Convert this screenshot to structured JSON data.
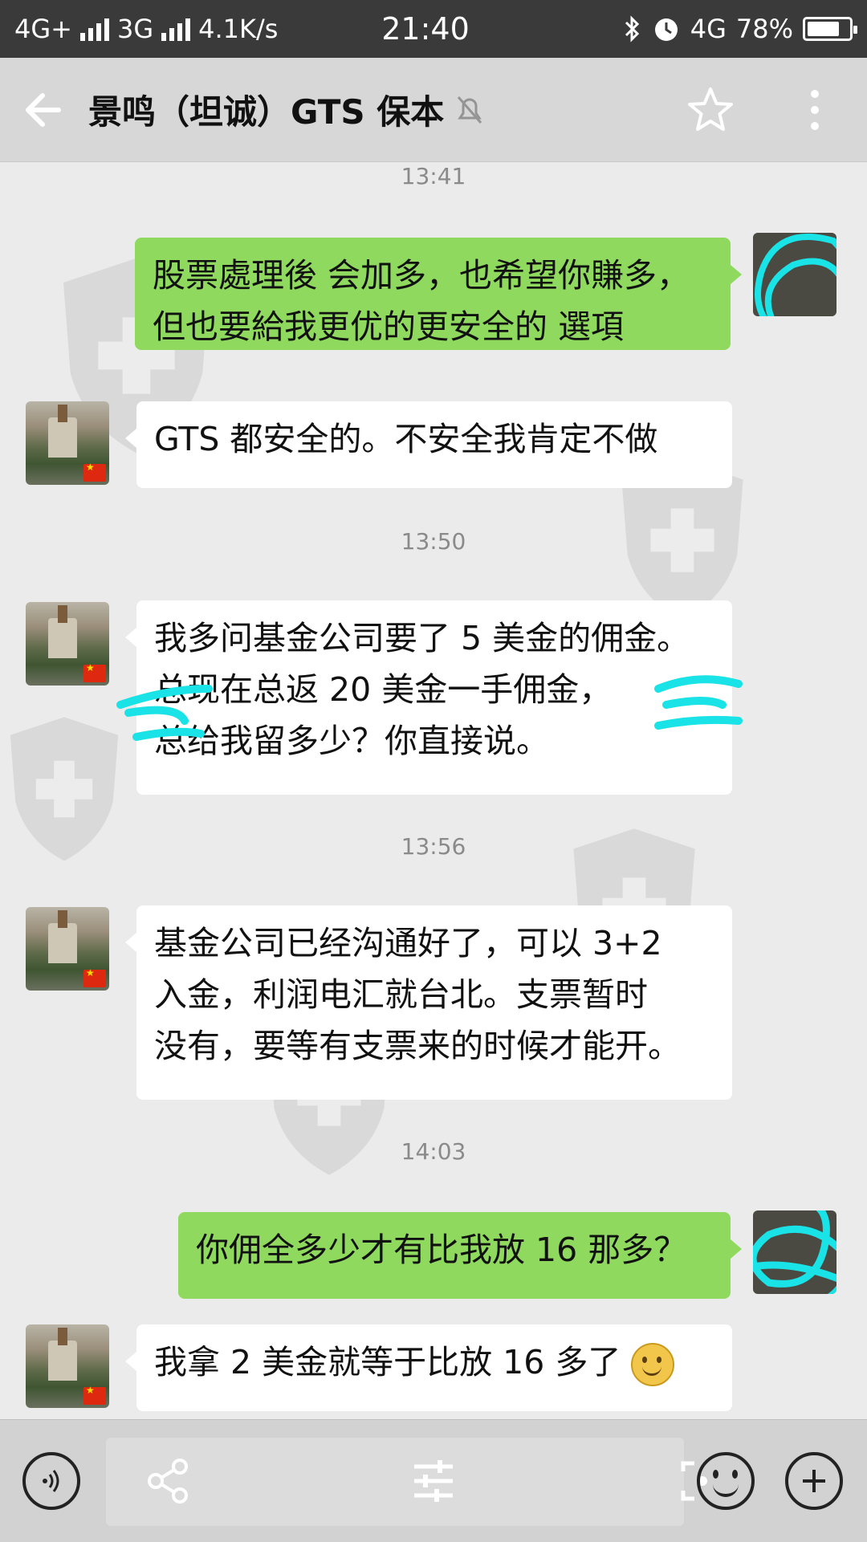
{
  "status_bar": {
    "left_text": "4G+",
    "left_text_2": "3G",
    "speed": "4.1K/s",
    "time": "21:40",
    "network_right": "4G",
    "battery": "78%",
    "battery_level": 0.78
  },
  "header": {
    "title": "景鸣（坦诚）GTS 保本"
  },
  "messages": [
    {
      "type": "timestamp",
      "text": "13:41"
    },
    {
      "type": "out",
      "lines": [
        "股票處理後 会加多，也希望你賺多，",
        "但也要給我更优的更安全的 選項"
      ]
    },
    {
      "type": "in",
      "lines": [
        "GTS 都安全的。不安全我肯定不做"
      ]
    },
    {
      "type": "timestamp",
      "text": "13:50"
    },
    {
      "type": "in",
      "lines": [
        "我多问基金公司要了 5 美金的佣金。",
        "总现在总返 20 美金一手佣金，",
        "总给我留多少？你直接说。"
      ]
    },
    {
      "type": "timestamp",
      "text": "13:56"
    },
    {
      "type": "in",
      "lines": [
        "基金公司已经沟通好了，可以 3+2",
        "入金，利润电汇就台北。支票暂时",
        "没有，要等有支票来的时候才能开。"
      ]
    },
    {
      "type": "timestamp",
      "text": "14:03"
    },
    {
      "type": "out",
      "lines": [
        "你佣全多少才有比我放 16 那多？"
      ]
    },
    {
      "type": "in",
      "lines": [
        "我拿 2 美金就等于比放 16 多了"
      ]
    }
  ],
  "colors": {
    "outgoing_bubble": "#8fd95e",
    "incoming_bubble": "#ffffff",
    "background": "#ebebeb",
    "redaction": "#19e3e6"
  },
  "icons": {
    "back": "back-arrow-icon",
    "mute": "mute-bell-icon",
    "star": "star-icon",
    "more": "more-dots-icon",
    "voice": "voice-icon",
    "share": "share-icon",
    "adjust": "adjust-icon",
    "emoji": "emoji-icon",
    "plus": "plus-icon"
  }
}
